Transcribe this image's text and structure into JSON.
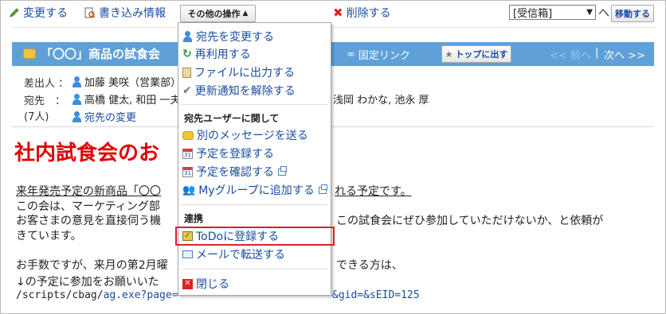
{
  "toolbar": {
    "change_label": "変更する",
    "write_info_label": "書き込み情報",
    "other_ops_label": "その他の操作",
    "delete_label": "削除する",
    "folder_select_value": "[受信箱]",
    "move_label": "移動する"
  },
  "message": {
    "title": "「〇〇」商品の試食会",
    "permalink_label": "固定リンク",
    "pin_top_label": "トップに出す",
    "prev_label": "<< 前へ",
    "nav_separator": "|",
    "next_label": "次へ >>",
    "sender_label": "差出人 ：",
    "sender_name": "加藤 美咲（営業部）",
    "to_label": "宛先　：",
    "to_count": "(7人)",
    "recipients_left": "高橋 健太, 和田 一夫",
    "recipients_right": "浅岡 わかな, 池永 厚",
    "change_recipients_label": "宛先の変更",
    "body_heading": "社内試食会のお",
    "body_lines": {
      "l1a": "来年発売予定の新商品「〇〇",
      "l1b": "れる予定です。",
      "l2a": "この会は、マーケティング部",
      "l3a": "お客さまの意見を直接伺う機",
      "l3b": "この試食会にぜひ参加していただけないか、と依頼が",
      "l4": "きています。",
      "l5a": "お手数ですが、来月の第2月曜",
      "l5b": "できる方は、",
      "l6": "↓の予定に参加をお願いいた",
      "url_prefix": "/scripts/cbag/",
      "url_link": "ag.exe?page=",
      "url_suffix": "&gid=&sEID=125"
    }
  },
  "menu": {
    "items_top": [
      "宛先を変更する",
      "再利用する",
      "ファイルに出力する",
      "更新通知を解除する"
    ],
    "section_recipients": "宛先ユーザーに関して",
    "items_recipients": [
      "別のメッセージを送る",
      "予定を登録する",
      "予定を確認する",
      "Myグループに追加する"
    ],
    "section_link": "連携",
    "items_link": [
      "ToDoに登録する",
      "メールで転送する"
    ],
    "close_label": "閉じる"
  },
  "colors": {
    "accent": "#1a4da1",
    "title_bar": "#5fa0d8",
    "heading_red": "#e00000",
    "highlight_red": "#e02020"
  }
}
